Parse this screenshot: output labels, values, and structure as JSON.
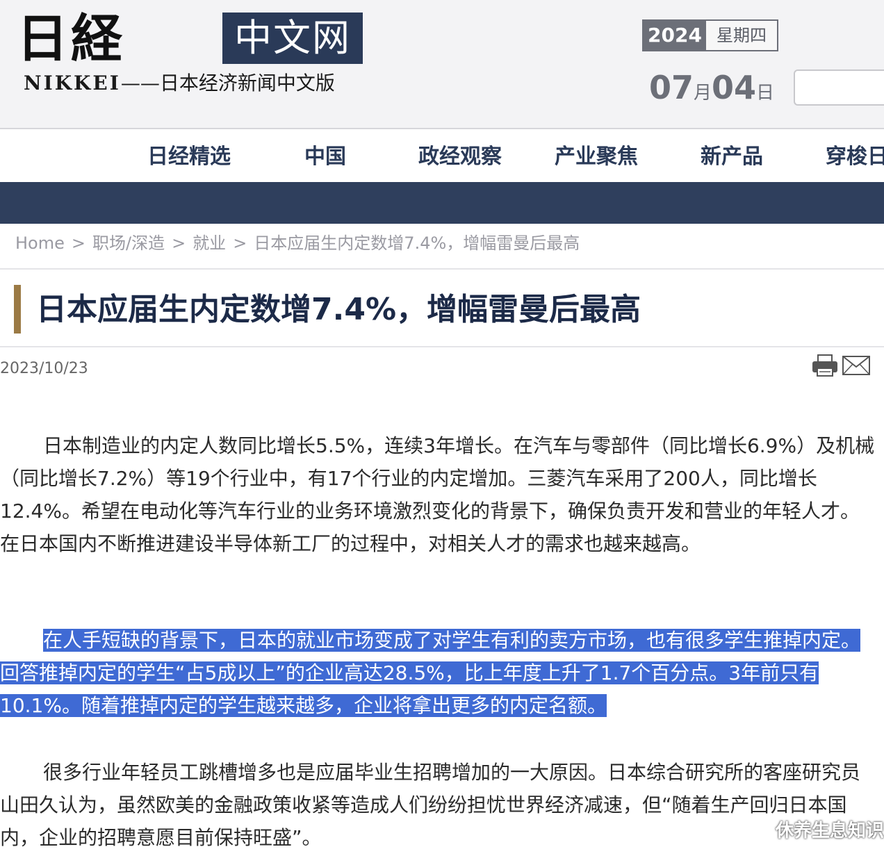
{
  "header": {
    "logo_mark": "日経",
    "logo_box": "中文网",
    "logo_sub_en": "NIKKEI",
    "logo_sub_cn": "——日本经济新闻中文版",
    "date_year": "2024",
    "date_weekday": "星期四",
    "date_month": "07",
    "date_month_unit": "月",
    "date_day": "04",
    "date_day_unit": "日",
    "search_placeholder": ""
  },
  "nav": {
    "items": [
      "日经精选",
      "中国",
      "政经观察",
      "产业聚焦",
      "新产品",
      "穿梭日"
    ]
  },
  "breadcrumb": {
    "items": [
      "Home",
      "职场/深造",
      "就业",
      "日本应届生内定数增7.4%，增幅雷曼后最高"
    ],
    "separator": ">"
  },
  "article": {
    "title": "日本应届生内定数增7.4%，增幅雷曼后最高",
    "date": "2023/10/23",
    "paragraphs": [
      "日本制造业的内定人数同比增长5.5%，连续3年增长。在汽车与零部件（同比增长6.9%）及机械（同比增长7.2%）等19个行业中，有17个行业的内定增加。三菱汽车采用了200人，同比增长12.4%。希望在电动化等汽车行业的业务环境激烈变化的背景下，确保负责开发和营业的年轻人才。在日本国内不断推进建设半导体新工厂的过程中，对相关人才的需求也越来越高。",
      "在人手短缺的背景下，日本的就业市场变成了对学生有利的卖方市场，也有很多学生推掉内定。回答推掉内定的学生“占5成以上”的企业高达28.5%，比上年度上升了1.7个百分点。3年前只有10.1%。随着推掉内定的学生越来越多，企业将拿出更多的内定名额。",
      "很多行业年轻员工跳槽增多也是应届毕业生招聘增加的一大原因。日本综合研究所的客座研究员山田久认为，虽然欧美的金融政策收紧等造成人们纷纷担忧世界经济减速，但“随着生产回归日本国内，企业的招聘意愿目前保持旺盛”。"
    ]
  },
  "watermark": "休养生息知识",
  "colors": {
    "navy": "#2f3f5d",
    "title_accent": "#9b7a45",
    "selection": "#3f6ad4"
  },
  "icons": [
    "print-icon",
    "mail-icon"
  ]
}
